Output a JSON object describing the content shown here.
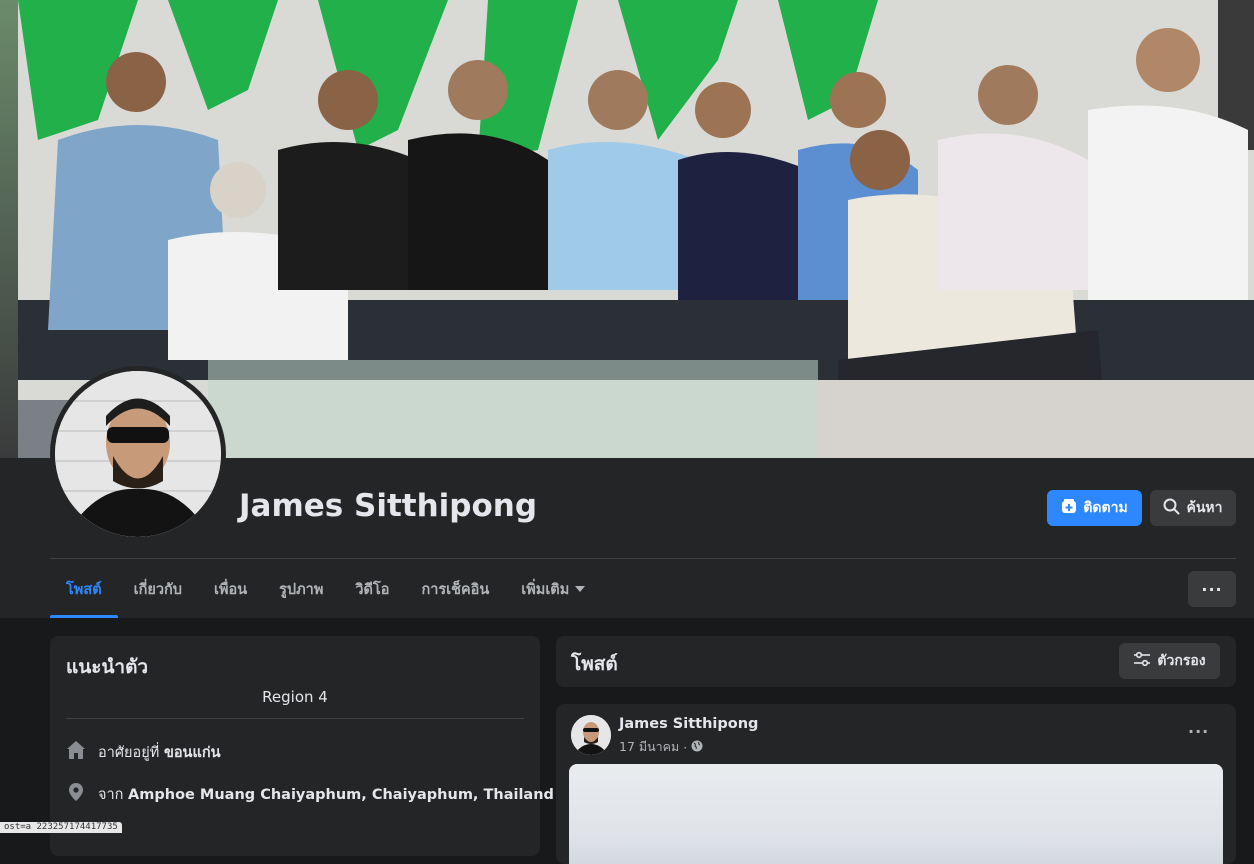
{
  "profile": {
    "name": "James Sitthipong"
  },
  "actions": {
    "follow_label": "ติดตาม",
    "search_label": "ค้นหา",
    "more_label": "···"
  },
  "tabs": [
    {
      "label": "โพสต์",
      "active": true
    },
    {
      "label": "เกี่ยวกับ",
      "active": false
    },
    {
      "label": "เพื่อน",
      "active": false
    },
    {
      "label": "รูปภาพ",
      "active": false
    },
    {
      "label": "วิดีโอ",
      "active": false
    },
    {
      "label": "การเช็คอิน",
      "active": false
    },
    {
      "label": "เพิ่มเติม",
      "active": false,
      "dropdown": true
    }
  ],
  "intro": {
    "title": "แนะนำตัว",
    "bio": "Region 4",
    "lives_prefix": "อาศัยอยู่ที่",
    "lives_value": "ขอนแก่น",
    "from_prefix": "จาก",
    "from_value": "Amphoe Muang Chaiyaphum, Chaiyaphum, Thailand"
  },
  "posts": {
    "title": "โพสต์",
    "filter_label": "ตัวกรอง",
    "items": [
      {
        "author": "James Sitthipong",
        "date": "17 มีนาคม",
        "privacy_icon": "globe-icon",
        "more_label": "···"
      }
    ]
  },
  "status_bar": {
    "text": "ost=a 223257174417735"
  },
  "colors": {
    "accent": "#2d88ff",
    "surface": "#242526",
    "background": "#18191a",
    "button": "#3a3b3c",
    "text_primary": "#e4e6eb",
    "text_secondary": "#b0b3b8"
  }
}
